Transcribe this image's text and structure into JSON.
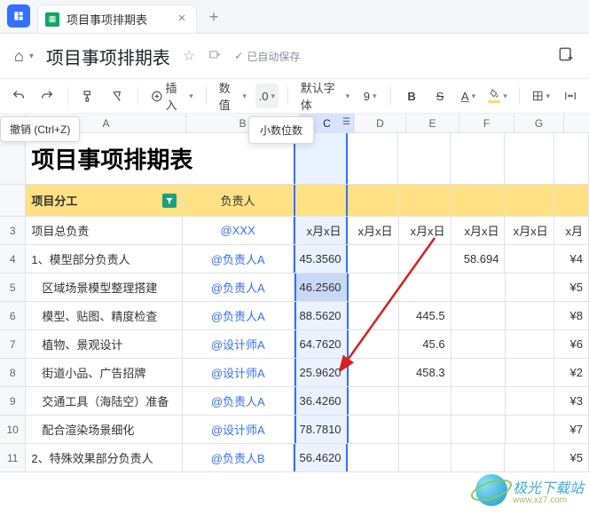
{
  "tab": {
    "title": "项目事项排期表"
  },
  "doc": {
    "title": "项目事项排期表",
    "saved": "已自动保存"
  },
  "toolbar": {
    "insert": "插入",
    "format": "数值",
    "decimal": ".0",
    "font": "默认字体",
    "size": "9",
    "undo_tip": "撤销 (Ctrl+Z)",
    "decimal_tip": "小数位数"
  },
  "cols": [
    "A",
    "B",
    "C",
    "D",
    "E",
    "F",
    "G"
  ],
  "sheet": {
    "title": "项目事项排期表",
    "h_a": "项目分工",
    "h_b": "负责人",
    "rows": [
      {
        "n": "3",
        "a": "项目总负责",
        "b": "@XXX",
        "c": "x月x日",
        "d": "x月x日",
        "e": "x月x日",
        "f": "x月x日",
        "g": "x月x日",
        "h": "x月"
      },
      {
        "n": "4",
        "a": "1、模型部分负责人",
        "b": "@负责人A",
        "c": "45.3560",
        "d": "",
        "e": "",
        "f": "58.694",
        "g": "",
        "h": "¥4"
      },
      {
        "n": "5",
        "a": "区域场景模型整理搭建",
        "b": "@负责人A",
        "c": "46.2560",
        "d": "",
        "e": "",
        "f": "",
        "g": "",
        "h": "¥5"
      },
      {
        "n": "6",
        "a": "模型、贴图、精度检查",
        "b": "@负责人A",
        "c": "88.5620",
        "d": "",
        "e": "445.5",
        "f": "",
        "g": "",
        "h": "¥8"
      },
      {
        "n": "7",
        "a": "植物、景观设计",
        "b": "@设计师A",
        "c": "64.7620",
        "d": "",
        "e": "45.6",
        "f": "",
        "g": "",
        "h": "¥6"
      },
      {
        "n": "8",
        "a": "街道小品、广告招牌",
        "b": "@设计师A",
        "c": "25.9620",
        "d": "",
        "e": "458.3",
        "f": "",
        "g": "",
        "h": "¥2"
      },
      {
        "n": "9",
        "a": "交通工具（海陆空）准备",
        "b": "@负责人A",
        "c": "36.4260",
        "d": "",
        "e": "",
        "f": "",
        "g": "",
        "h": "¥3"
      },
      {
        "n": "10",
        "a": "配合渲染场景细化",
        "b": "@设计师A",
        "c": "78.7810",
        "d": "",
        "e": "",
        "f": "",
        "g": "",
        "h": "¥7"
      },
      {
        "n": "11",
        "a": "2、特殊效果部分负责人",
        "b": "@负责人B",
        "c": "56.4620",
        "d": "",
        "e": "",
        "f": "",
        "g": "",
        "h": "¥5"
      }
    ]
  },
  "watermark": {
    "name": "极光下载站",
    "url": "www.xz7.com"
  }
}
